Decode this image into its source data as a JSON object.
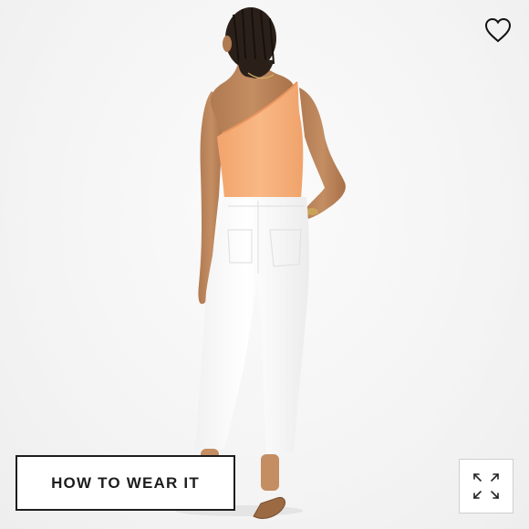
{
  "image": {
    "subject": "model-back-view",
    "top_color": "#f7b07a",
    "pants_color": "#ffffff",
    "background_color": "#f3f3f3"
  },
  "wishlist": {
    "icon": "heart-outline-icon"
  },
  "how_to_wear": {
    "label": "HOW TO WEAR IT"
  },
  "expand": {
    "icon": "expand-arrows-icon"
  }
}
